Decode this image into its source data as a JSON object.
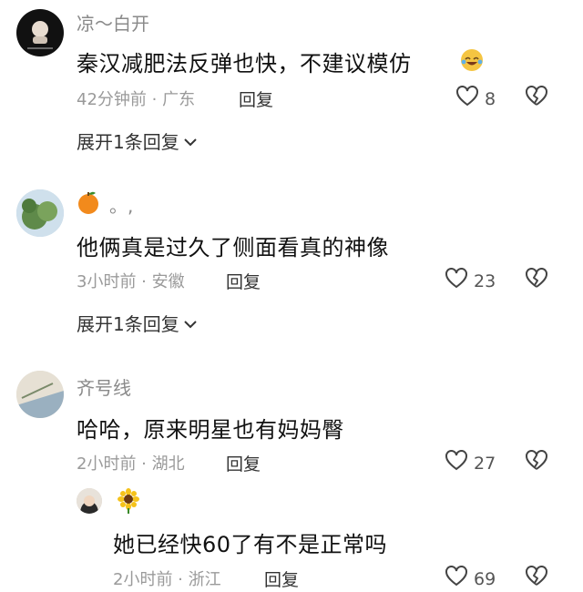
{
  "comments": [
    {
      "username": "凉～白开",
      "text": "秦汉减肥法反弹也快，不建议模仿",
      "time_location": "42分钟前 · 广东",
      "reply_label": "回复",
      "likes": "8",
      "expand_label": "展开1条回复"
    },
    {
      "username": "。,",
      "text": "他俩真是过久了侧面看真的神像",
      "time_location": "3小时前 · 安徽",
      "reply_label": "回复",
      "likes": "23",
      "expand_label": "展开1条回复"
    },
    {
      "username": "齐号线",
      "text": "哈哈，原来明星也有妈妈臀",
      "time_location": "2小时前 · 湖北",
      "reply_label": "回复",
      "likes": "27"
    }
  ],
  "reply": {
    "text": "她已经快60了有不是正常吗",
    "time_location": "2小时前 · 浙江",
    "reply_label": "回复",
    "likes": "69"
  },
  "colors": {
    "meta": "#9a9a9a",
    "text": "#111111",
    "avatar1": "#111111"
  }
}
